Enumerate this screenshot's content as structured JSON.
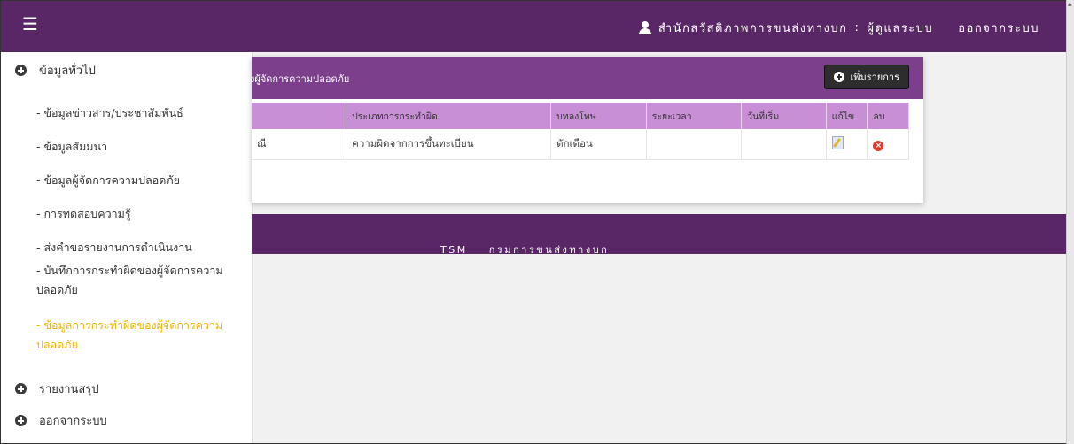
{
  "header": {
    "org_name": "สำนักสวัสดิภาพการขนส่งทางบก",
    "separator": ":",
    "role": "ผู้ดูแลระบบ",
    "logout": "ออกจากระบบ"
  },
  "sidebar": {
    "groups": [
      {
        "label": "ข้อมูลทั่วไป"
      },
      {
        "label": "รายงานสรุป"
      },
      {
        "label": "ออกจากระบบ"
      }
    ],
    "items": [
      {
        "label": "- ข้อมูลข่าวสาร/ประชาสัมพันธ์"
      },
      {
        "label": "- ข้อมูลสัมมนา"
      },
      {
        "label": "- ข้อมูลผู้จัดการความปลอดภัย"
      },
      {
        "label": "- การทดสอบความรู้"
      },
      {
        "label": "- ส่งคำขอรายงานการดำเนินงาน"
      },
      {
        "label": "- บันทึกการกระทำผิดของผู้จัดการความปลอดภัย"
      },
      {
        "label": "- ข้อมูลการกระทำผิดของผู้จัดการความปลอดภัย",
        "active": true
      }
    ]
  },
  "main": {
    "title": "งผู้จัดการความปลอดภัย",
    "add_button": "เพิ่มรายการ",
    "columns": [
      "",
      "ประเภทการกระทำผิด",
      "บทลงโทษ",
      "ระยะเวลา",
      "วันที่เริ่ม",
      "แก้ไข",
      "ลบ"
    ],
    "rows": [
      {
        "name": "ณี",
        "offense": "ความผิดจากการขึ้นทะเบียน",
        "penalty": "ตักเตือน",
        "duration": "",
        "start_date": ""
      }
    ]
  },
  "footer": {
    "left": "TSM",
    "right": "กรมการขนส่งทางบก"
  },
  "colors": {
    "topbar": "#5a2766",
    "card_header": "#7b3f8c",
    "table_header": "#c88fd6",
    "active_menu": "#f0b400"
  }
}
